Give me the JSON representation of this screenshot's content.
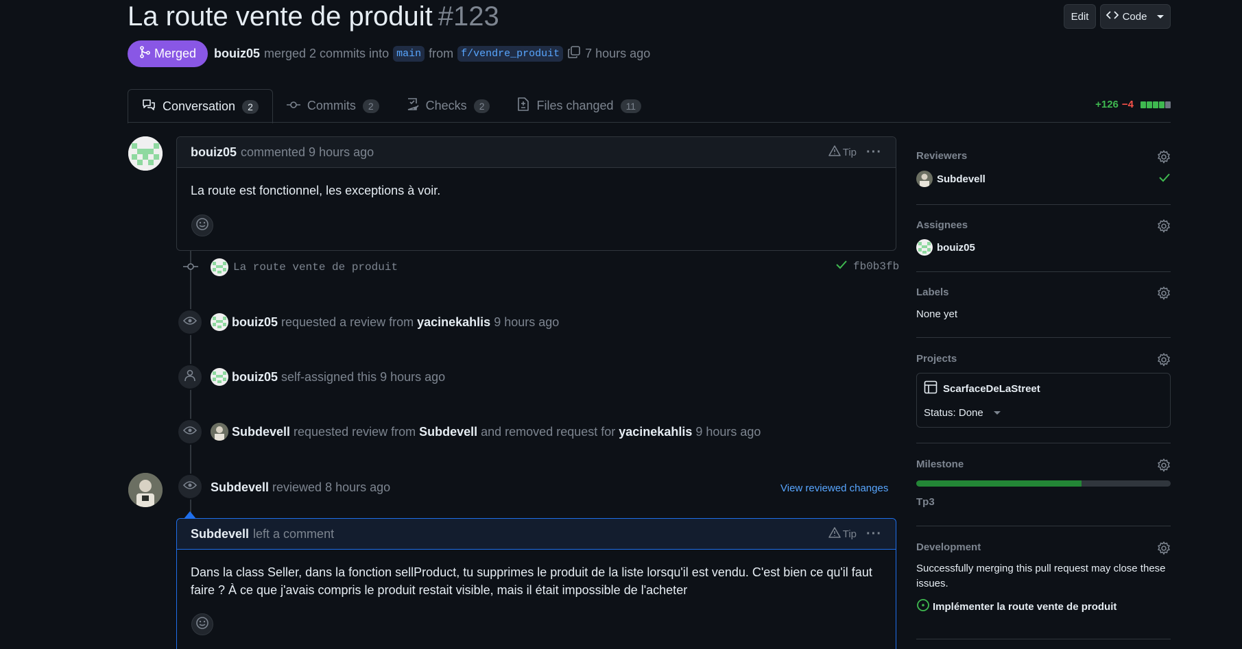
{
  "header": {
    "title": "La route vente de produit",
    "number": "#123",
    "edit_label": "Edit",
    "code_label": "Code",
    "state_label": "Merged",
    "author": "bouiz05",
    "merged_text": "merged 2 commits into",
    "base_branch": "main",
    "from_text": "from",
    "head_branch": "f/vendre_produit",
    "time": "7 hours ago"
  },
  "tabs": [
    {
      "label": "Conversation",
      "count": "2",
      "icon": "comment-discussion-icon"
    },
    {
      "label": "Commits",
      "count": "2",
      "icon": "git-commit-icon"
    },
    {
      "label": "Checks",
      "count": "2",
      "icon": "checklist-icon"
    },
    {
      "label": "Files changed",
      "count": "11",
      "icon": "file-diff-icon"
    }
  ],
  "diffstat": {
    "additions": "+126",
    "deletions": "−4",
    "colors": {
      "add": "#3fb950",
      "del": "#f85149"
    }
  },
  "timeline": {
    "comment1": {
      "author": "bouiz05",
      "action": "commented 9 hours ago",
      "tip": "Tip",
      "body": "La route est fonctionnel, les exceptions à voir."
    },
    "commit": {
      "message": "La route vente de produit",
      "sha": "fb0b3fb"
    },
    "event1": {
      "actor": "bouiz05",
      "text": "requested a review from",
      "target": "yacinekahlis",
      "time": "9 hours ago"
    },
    "event2": {
      "actor": "bouiz05",
      "text": "self-assigned this 9 hours ago"
    },
    "event3": {
      "actor": "Subdevell",
      "text": "requested review from",
      "target": "Subdevell",
      "text2": "and removed request for",
      "target2": "yacinekahlis",
      "time": "9 hours ago"
    },
    "review": {
      "actor": "Subdevell",
      "text": "reviewed 8 hours ago",
      "link": "View reviewed changes"
    },
    "comment2": {
      "author": "Subdevell",
      "action": "left a comment",
      "tip": "Tip",
      "body": "Dans la class Seller, dans la fonction sellProduct, tu supprimes le produit de la liste lorsqu'il est vendu. C'est bien ce qu'il faut faire ? À ce que j'avais compris le produit restait visible, mais il était impossible de l'acheter"
    }
  },
  "sidebar": {
    "reviewers": {
      "heading": "Reviewers",
      "user": "Subdevell"
    },
    "assignees": {
      "heading": "Assignees",
      "user": "bouiz05"
    },
    "labels": {
      "heading": "Labels",
      "value": "None yet"
    },
    "projects": {
      "heading": "Projects",
      "project": "ScarfaceDeLaStreet",
      "status": "Status: Done"
    },
    "milestone": {
      "heading": "Milestone",
      "name": "Tp3",
      "progress": 0.65
    },
    "development": {
      "heading": "Development",
      "description": "Successfully merging this pull request may close these issues.",
      "issue": "Implémenter la route vente de produit"
    }
  }
}
